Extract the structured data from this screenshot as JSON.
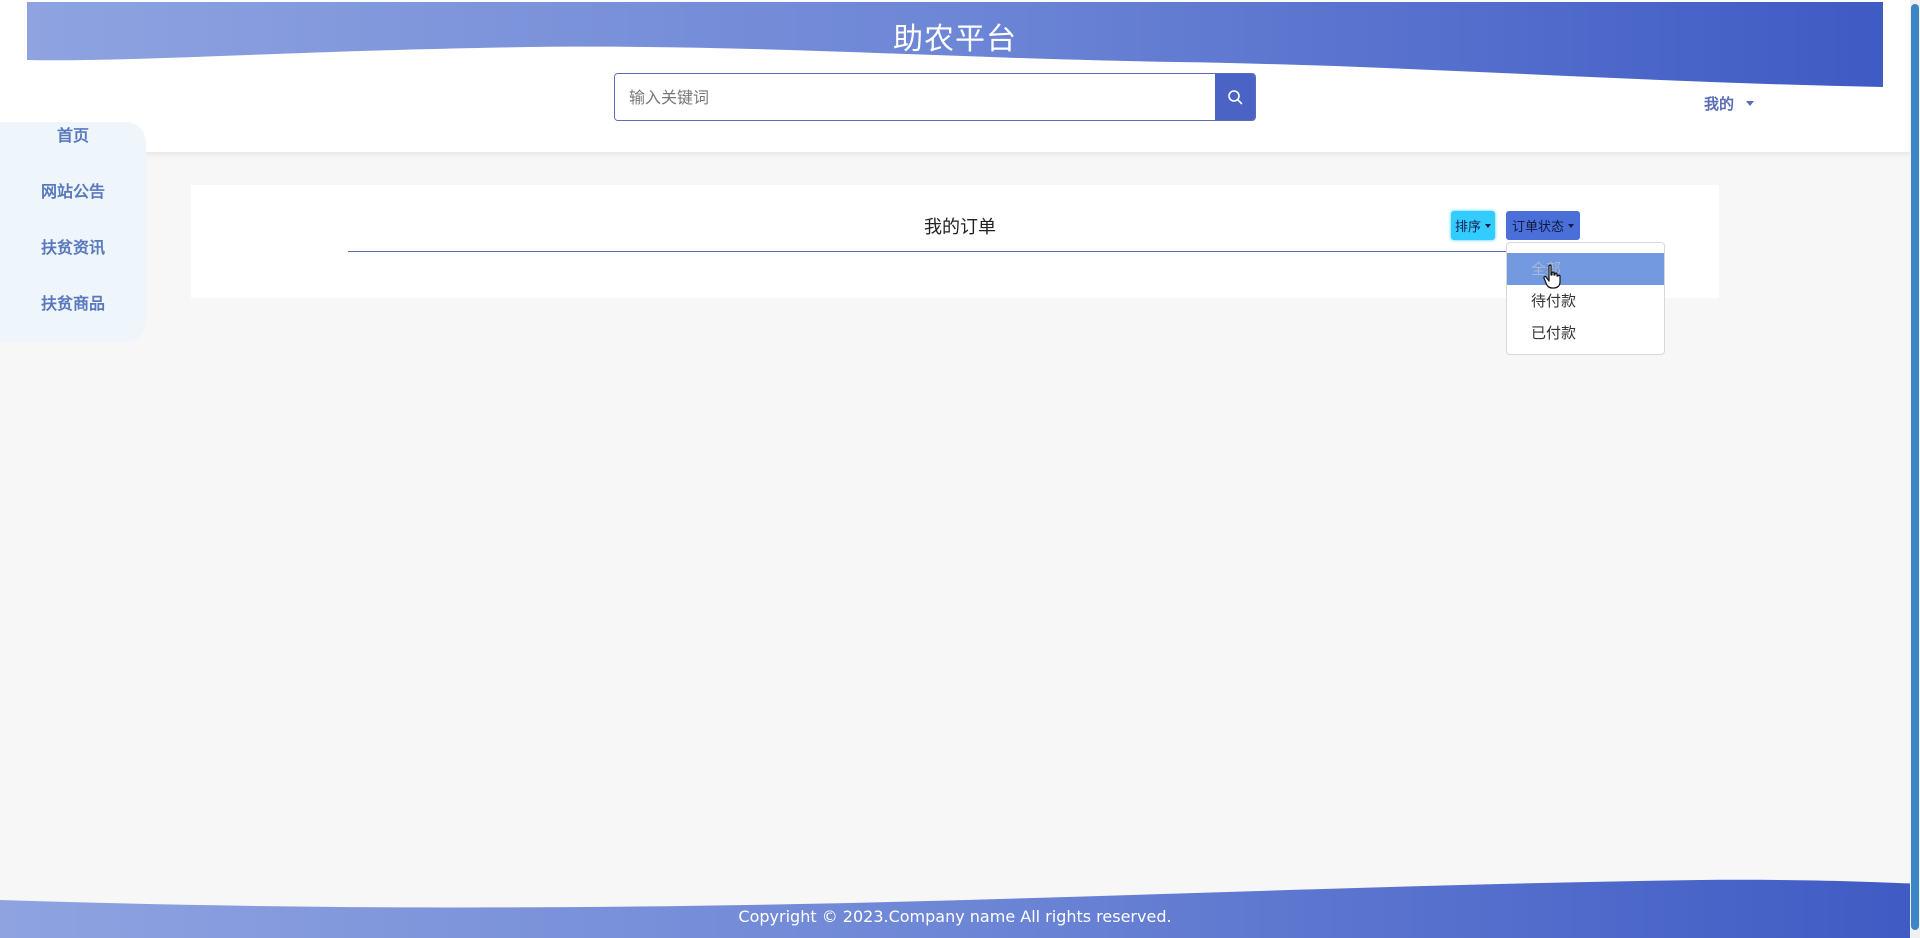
{
  "header": {
    "site_title": "助农平台",
    "search_placeholder": "输入关键词",
    "user_menu_label": "我的"
  },
  "sidebar": {
    "items": [
      {
        "label": "首页"
      },
      {
        "label": "网站公告"
      },
      {
        "label": "扶贫资讯"
      },
      {
        "label": "扶贫商品"
      }
    ]
  },
  "orders": {
    "title": "我的订单",
    "sort_label": "排序",
    "status_label": "订单状态",
    "status_options": [
      {
        "label": "全部",
        "active": true
      },
      {
        "label": "待付款",
        "active": false
      },
      {
        "label": "已付款",
        "active": false
      }
    ]
  },
  "footer": {
    "copyright": "Copyright © 2023.Company name All rights reserved."
  },
  "colors": {
    "brand_blue": "#4a63c4",
    "wave_light": "#8ea3e0",
    "nav_text": "#5a79bd",
    "sort_button": "#33ccff",
    "status_button": "#4a6fd8"
  },
  "icons": {
    "search": "magnifier-icon",
    "caret": "chevron-down-icon",
    "cursor": "hand-pointer-icon"
  }
}
